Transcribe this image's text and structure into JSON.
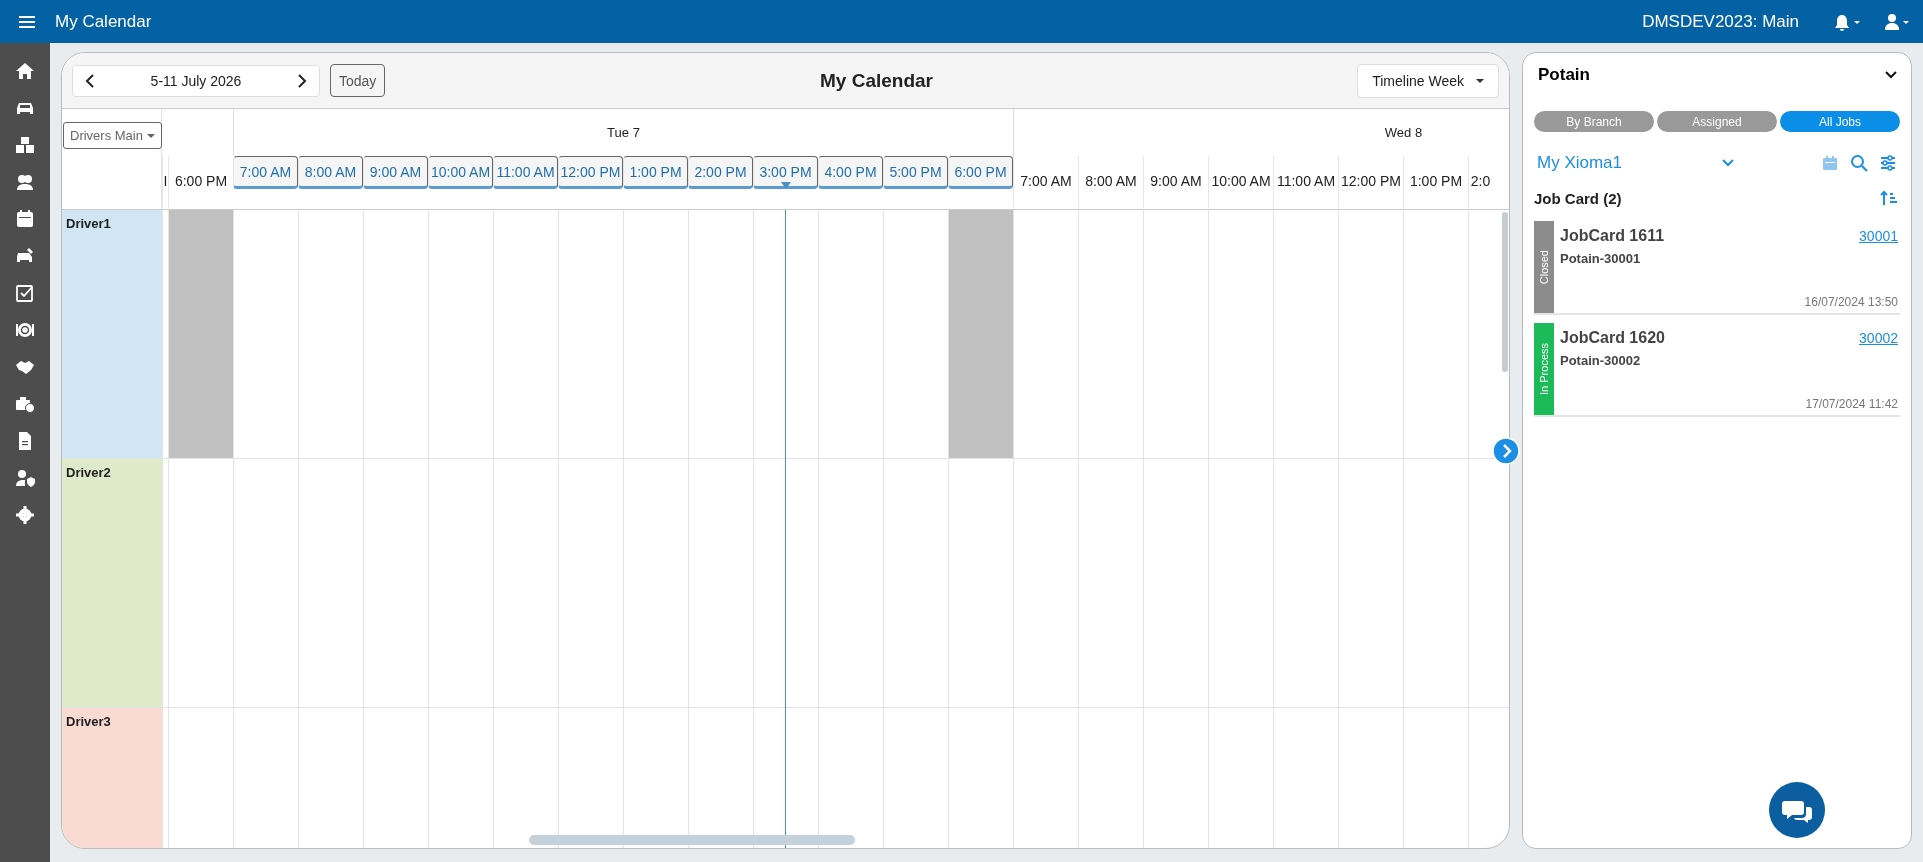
{
  "topbar": {
    "title": "My Calendar",
    "workspace": "DMSDEV2023: Main"
  },
  "calendar": {
    "date_range": "5-11 July 2026",
    "today_button": "Today",
    "title": "My Calendar",
    "view": "Timeline Week",
    "resource_group": "Drivers Main",
    "leading_slots": [
      {
        "label": "I",
        "kind": "partial",
        "today": false,
        "evening": false,
        "now": false
      },
      {
        "label": "6:00 PM",
        "kind": "hour",
        "today": false,
        "evening": true,
        "now": false
      }
    ],
    "days": [
      {
        "label": "Tue 7",
        "slots": [
          {
            "label": "7:00 AM",
            "kind": "hour",
            "today": true,
            "evening": false,
            "now": false
          },
          {
            "label": "8:00 AM",
            "kind": "hour",
            "today": true,
            "evening": false,
            "now": false
          },
          {
            "label": "9:00 AM",
            "kind": "hour",
            "today": true,
            "evening": false,
            "now": false
          },
          {
            "label": "10:00 AM",
            "kind": "hour",
            "today": true,
            "evening": false,
            "now": false
          },
          {
            "label": "11:00 AM",
            "kind": "hour",
            "today": true,
            "evening": false,
            "now": false
          },
          {
            "label": "12:00 PM",
            "kind": "hour",
            "today": true,
            "evening": false,
            "now": false
          },
          {
            "label": "1:00 PM",
            "kind": "hour",
            "today": true,
            "evening": false,
            "now": false
          },
          {
            "label": "2:00 PM",
            "kind": "hour",
            "today": true,
            "evening": false,
            "now": false
          },
          {
            "label": "3:00 PM",
            "kind": "hour",
            "today": true,
            "evening": false,
            "now": true
          },
          {
            "label": "4:00 PM",
            "kind": "hour",
            "today": true,
            "evening": false,
            "now": false
          },
          {
            "label": "5:00 PM",
            "kind": "hour",
            "today": true,
            "evening": false,
            "now": false
          },
          {
            "label": "6:00 PM",
            "kind": "hour",
            "today": true,
            "evening": true,
            "now": false
          }
        ]
      },
      {
        "label": "Wed 8",
        "slots": [
          {
            "label": "7:00 AM",
            "kind": "hour",
            "today": false,
            "evening": false,
            "now": false
          },
          {
            "label": "8:00 AM",
            "kind": "hour",
            "today": false,
            "evening": false,
            "now": false
          },
          {
            "label": "9:00 AM",
            "kind": "hour",
            "today": false,
            "evening": false,
            "now": false
          },
          {
            "label": "10:00 AM",
            "kind": "hour",
            "today": false,
            "evening": false,
            "now": false
          },
          {
            "label": "11:00 AM",
            "kind": "hour",
            "today": false,
            "evening": false,
            "now": false
          },
          {
            "label": "12:00 PM",
            "kind": "hour",
            "today": false,
            "evening": false,
            "now": false
          },
          {
            "label": "1:00 PM",
            "kind": "hour",
            "today": false,
            "evening": false,
            "now": false
          },
          {
            "label": "2:0",
            "kind": "partial",
            "today": false,
            "evening": false,
            "now": false
          }
        ]
      }
    ],
    "drivers": [
      {
        "name": "Driver1",
        "color": "#d0e6f4",
        "evening_blocked": true
      },
      {
        "name": "Driver2",
        "color": "#dfeacb",
        "evening_blocked": false
      },
      {
        "name": "Driver3",
        "color": "#fadbd3",
        "evening_blocked": false
      }
    ]
  },
  "jobs_panel": {
    "title": "Potain",
    "tabs": [
      {
        "label": "By Branch",
        "selected": false
      },
      {
        "label": "Assigned",
        "selected": false
      },
      {
        "label": "All Jobs",
        "selected": true
      }
    ],
    "filter": "My Xioma1",
    "list_title": "Job Card (2)",
    "cards": [
      {
        "status": "Closed",
        "color": "#8c8c8c",
        "title": "JobCard 1611",
        "subtitle": "Potain-30001",
        "link": "30001",
        "date": "16/07/2024 13:50"
      },
      {
        "status": "In Process",
        "color": "#1dba5a",
        "title": "JobCard 1620",
        "subtitle": "Potain-30002",
        "link": "30002",
        "date": "17/07/2024 11:42"
      }
    ]
  }
}
